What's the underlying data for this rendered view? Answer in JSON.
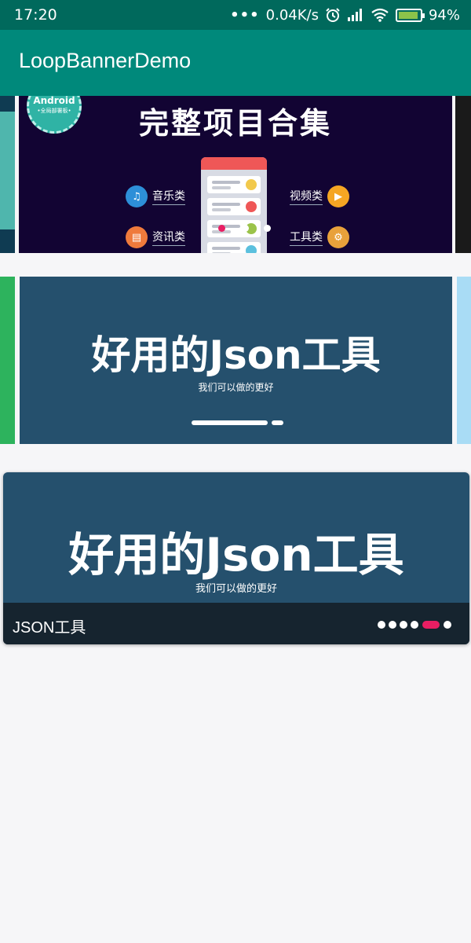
{
  "status_bar": {
    "time": "17:20",
    "net_speed": "0.04K/s",
    "battery": "94%",
    "icons": [
      "more-dots-icon",
      "alarm-icon",
      "signal-icon",
      "wifi-icon",
      "battery-charging-icon"
    ]
  },
  "app_bar": {
    "title": "LoopBannerDemo"
  },
  "banner1": {
    "title": "完整项目合集",
    "badge_title": "Android",
    "badge_subtitle": "•全局部署板•",
    "categories": [
      {
        "label": "音乐类",
        "icon": "music-icon",
        "color": "#2d8fd8"
      },
      {
        "label": "资讯类",
        "icon": "news-icon",
        "color": "#ef7a3c"
      },
      {
        "label": "视频类",
        "icon": "video-icon",
        "color": "#f5a623"
      },
      {
        "label": "工具类",
        "icon": "tools-icon",
        "color": "#e8a13b"
      }
    ],
    "indicator": {
      "count": 3,
      "active_index": 0,
      "active_color": "#e91e63"
    },
    "colors": {
      "bg": "#120433",
      "prev_edge": "#4fb6ad",
      "next_edge": "#1a1a1a"
    }
  },
  "banner2": {
    "title": "好用的Json工具",
    "subtitle": "我们可以做的更好",
    "colors": {
      "bg": "#25506d",
      "prev_edge": "#2db35d",
      "next_edge": "#a9dcf5"
    }
  },
  "banner3": {
    "title": "好用的Json工具",
    "subtitle": "我们可以做的更好",
    "caption": "JSON工具",
    "indicator": {
      "count": 6,
      "active_index": 4,
      "active_color": "#e91e63"
    }
  }
}
